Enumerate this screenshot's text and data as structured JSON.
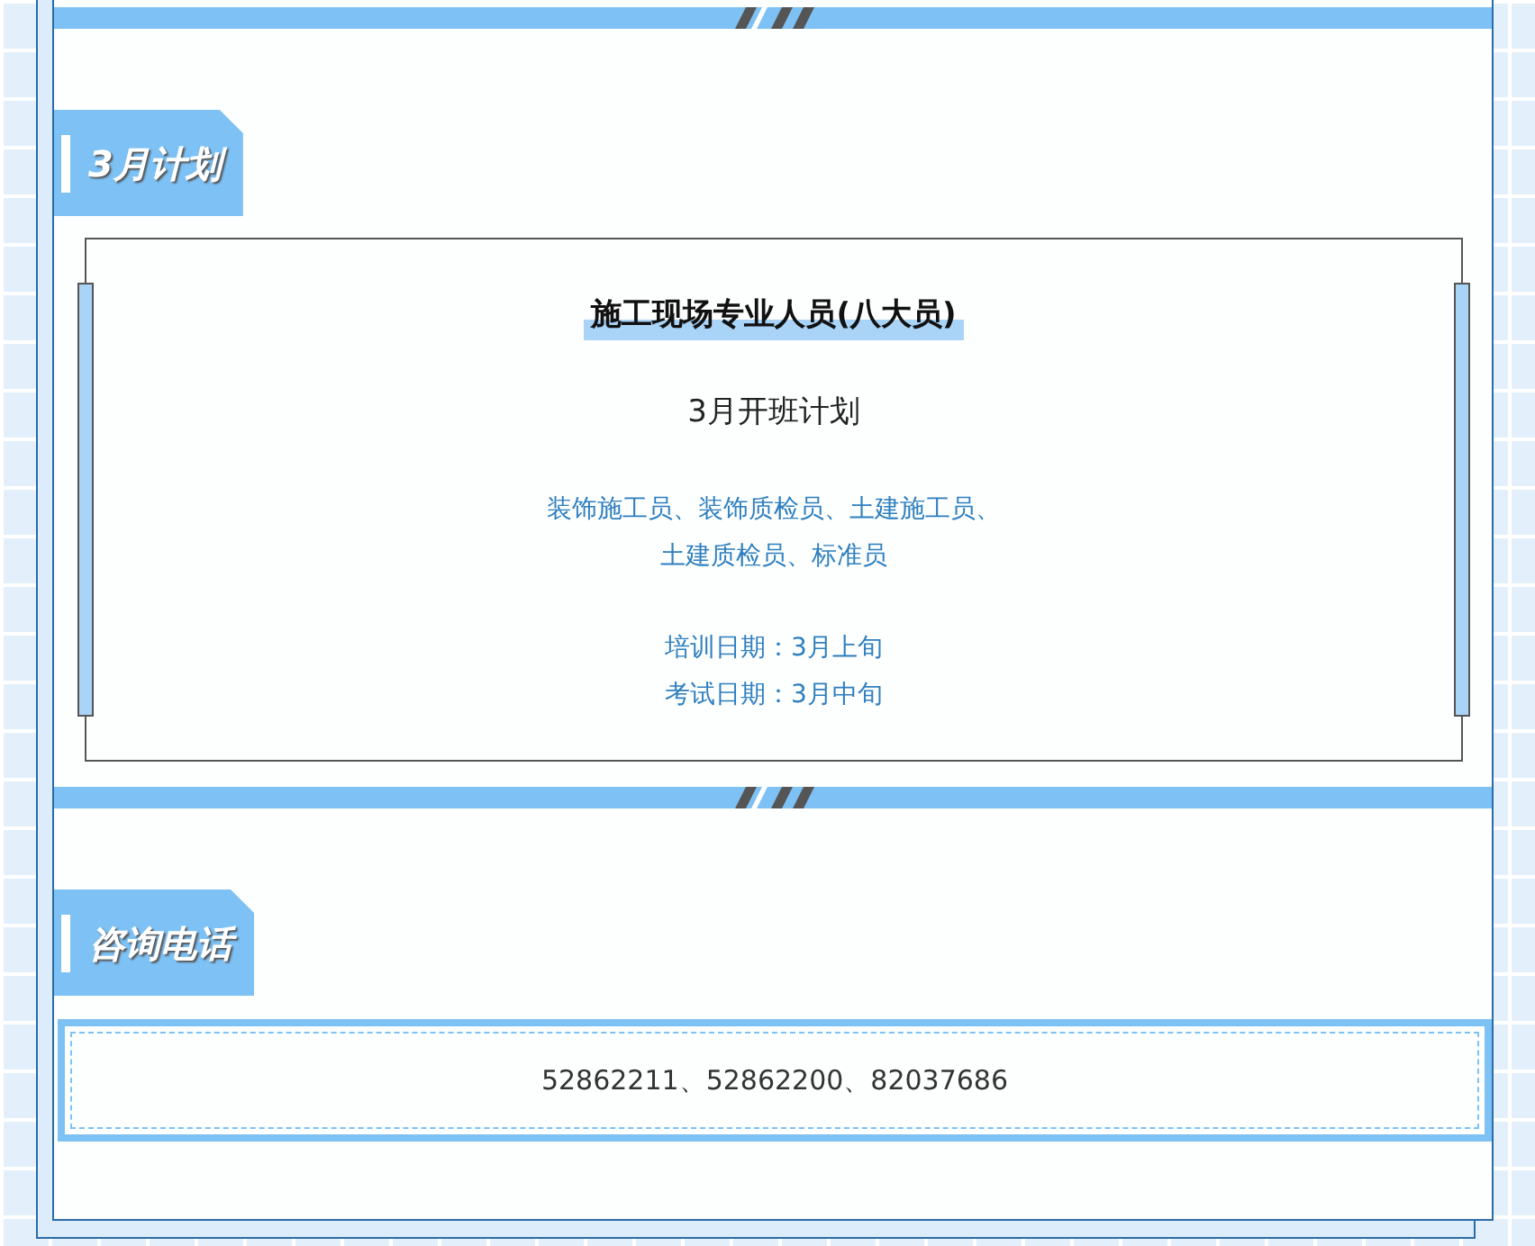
{
  "sections": [
    {
      "kind": "plan",
      "heading": "3月计划",
      "card": {
        "title": "施工现场专业人员(八大员)",
        "subtitle": "3月开班计划",
        "positions": [
          "装饰施工员、装饰质检员、土建施工员、",
          "土建质检员、标准员"
        ],
        "dates": [
          "培训日期：3月上旬",
          "考试日期：3月中旬"
        ]
      }
    },
    {
      "kind": "contact",
      "heading": "咨询电话",
      "phones": "52862211、52862200、82037686"
    }
  ]
}
